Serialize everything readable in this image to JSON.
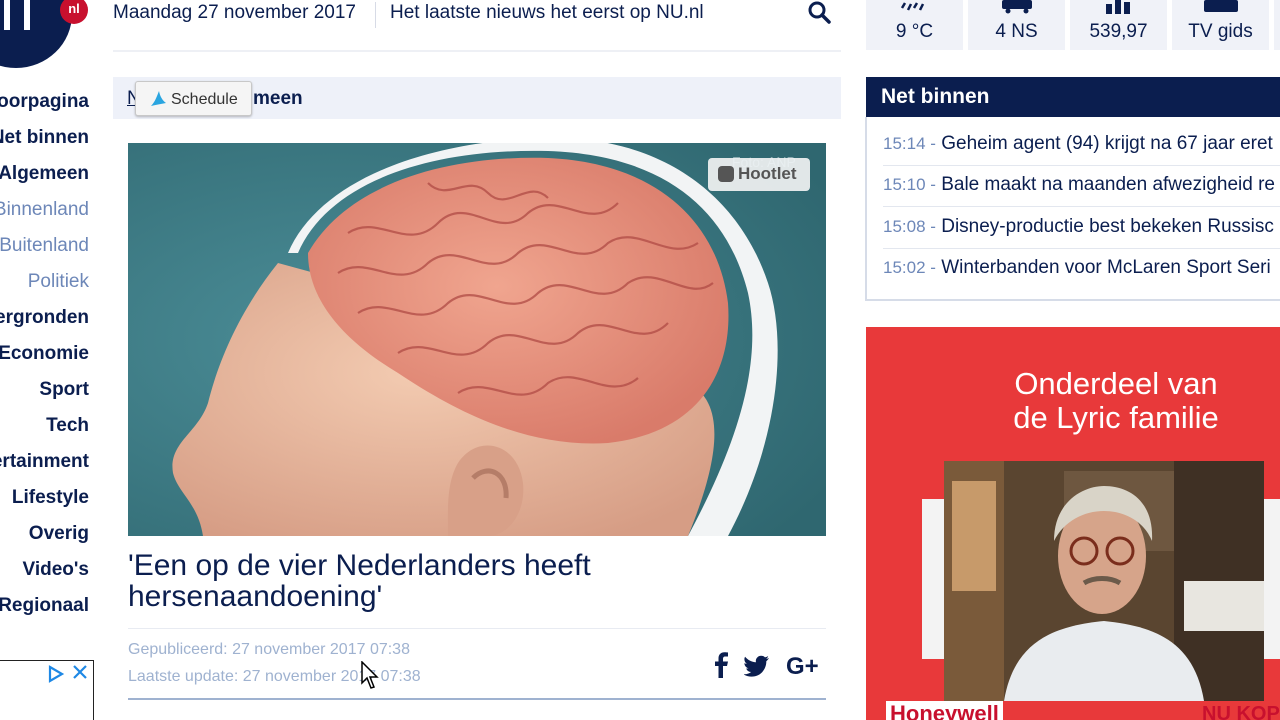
{
  "header": {
    "date": "Maandag 27 november 2017",
    "tagline": "Het laatste nieuws het eerst op NU.nl",
    "logo_badge": "nl",
    "widgets": [
      {
        "icon": "weather-icon",
        "value": "9 °C"
      },
      {
        "icon": "train-icon",
        "value": "4 NS"
      },
      {
        "icon": "stocks-icon",
        "value": "539,97"
      },
      {
        "icon": "tv-icon",
        "value": "TV gids"
      }
    ]
  },
  "nav": {
    "items": [
      {
        "label": "Voorpagina",
        "sub": false
      },
      {
        "label": "Net binnen",
        "sub": false
      },
      {
        "label": "Algemeen",
        "sub": false
      },
      {
        "label": "Binnenland",
        "sub": true
      },
      {
        "label": "Buitenland",
        "sub": true
      },
      {
        "label": "Politiek",
        "sub": true
      },
      {
        "label": "Achtergronden",
        "sub": false
      },
      {
        "label": "Economie",
        "sub": false
      },
      {
        "label": "Sport",
        "sub": false
      },
      {
        "label": "Tech",
        "sub": false
      },
      {
        "label": "Entertainment",
        "sub": false
      },
      {
        "label": "Lifestyle",
        "sub": false
      },
      {
        "label": "Overig",
        "sub": false
      },
      {
        "label": "Video's",
        "sub": false
      },
      {
        "label": "Regionaal",
        "sub": false
      }
    ]
  },
  "breadcrumb": {
    "home": "N",
    "section": "meen"
  },
  "schedule_button": "Schedule",
  "article": {
    "photo_credit": "Foto: ANP",
    "hootlet_label": "Hootlet",
    "headline": "'Een op de vier Nederlanders heeft hersenaandoening'",
    "published": "Gepubliceerd: 27 november 2017 07:38",
    "updated": "Laatste update: 27 november 2017 07:38"
  },
  "net_binnen": {
    "title": "Net binnen",
    "items": [
      {
        "time": "15:14 -",
        "headline": "Geheim agent (94) krijgt na 67 jaar eret"
      },
      {
        "time": "15:10 -",
        "headline": "Bale maakt na maanden afwezigheid re"
      },
      {
        "time": "15:08 -",
        "headline": "Disney-productie best bekeken Russisc"
      },
      {
        "time": "15:02 -",
        "headline": "Winterbanden voor McLaren Sport Seri"
      }
    ]
  },
  "ad": {
    "line1": "Onderdeel van",
    "line2": "de Lyric familie",
    "brand": "Honeywell",
    "brand_right": "NU KOP"
  },
  "colors": {
    "navy": "#0b1e4f",
    "accent_red": "#c8102e",
    "ad_red": "#e8393a",
    "muted": "#6d87b8"
  }
}
